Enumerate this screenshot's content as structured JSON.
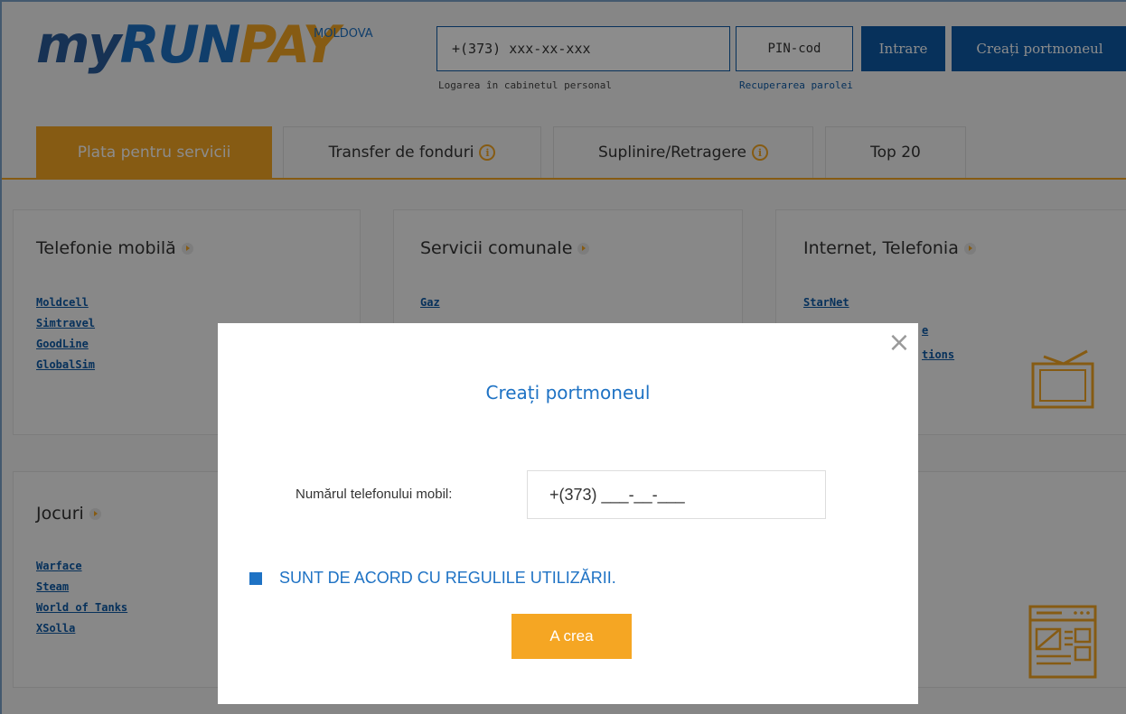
{
  "header": {
    "logo": {
      "my": "my",
      "run": "RUN",
      "pay": "PAY",
      "region": "MOLDOVA"
    },
    "phone_placeholder": "+(373) xxx-xx-xxx",
    "phone_hint": "Logarea în cabinetul personal",
    "pin_placeholder": "PIN-cod",
    "pin_hint": "Recuperarea parolei",
    "login_label": "Intrare",
    "create_wallet_label": "Creați portmoneul"
  },
  "tabs": [
    {
      "label": "Plata pentru servicii",
      "active": true
    },
    {
      "label": "Transfer de fonduri",
      "info": true
    },
    {
      "label": "Suplinire/Retragere",
      "info": true
    },
    {
      "label": "Top 20"
    }
  ],
  "categories": [
    {
      "title": "Telefonie mobilă",
      "links": [
        "Moldcell",
        "Simtravel",
        "GoodLine",
        "GlobalSim"
      ]
    },
    {
      "title": "Servicii comunale",
      "links": [
        "Gaz"
      ]
    },
    {
      "title": "Internet, Telefonia",
      "links": [
        "StarNet",
        "e",
        "tions"
      ]
    },
    {
      "title": "Jocuri",
      "links": [
        "Warface",
        "Steam",
        "World of Tanks",
        "XSolla"
      ]
    }
  ],
  "modal": {
    "close": "×",
    "title": "Creați portmoneul",
    "phone_label": "Numărul telefonului mobil:",
    "phone_mask": "+(373) ___-__-___",
    "agree_text": "SUNT DE ACORD CU REGULILE UTILIZĂRII.",
    "agree_checked": true,
    "submit_label": "A crea"
  },
  "colors": {
    "brand_blue": "#0d5aa7",
    "accent_orange": "#f5a623",
    "link_blue": "#1e72c4"
  },
  "icons": [
    "info-icon",
    "arrow-right-icon",
    "tv-icon",
    "news-icon",
    "close-icon"
  ]
}
